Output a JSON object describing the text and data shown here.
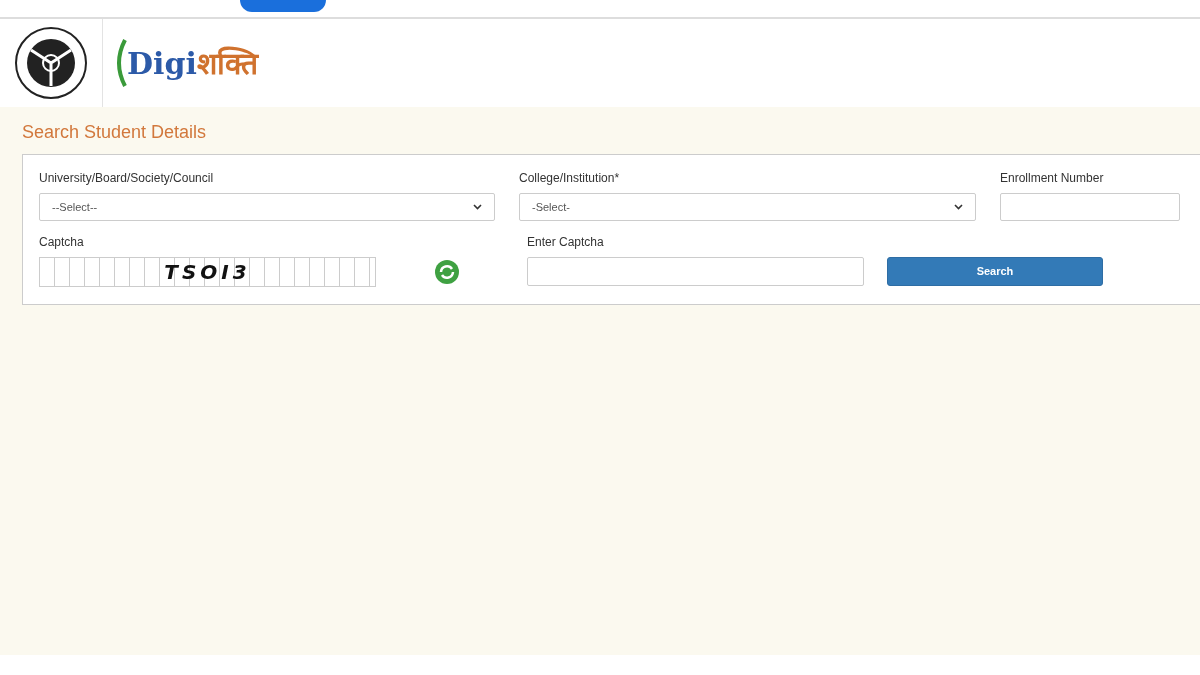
{
  "header": {
    "logo_text": {
      "latin": "Digi",
      "devanagari": "शक्ति"
    }
  },
  "page_title": "Search Student Details",
  "form": {
    "fields": [
      {
        "kind": "select",
        "label": "University/Board/Society/Council",
        "value": "--Select--"
      },
      {
        "kind": "select",
        "label": "College/Institution*",
        "value": "-Select-"
      },
      {
        "kind": "text",
        "label": "Enrollment Number"
      }
    ],
    "captcha": {
      "label": "Captcha",
      "code": "TSOI3"
    },
    "captcha_input": {
      "label": "Enter Captcha"
    },
    "submit": "Search"
  }
}
